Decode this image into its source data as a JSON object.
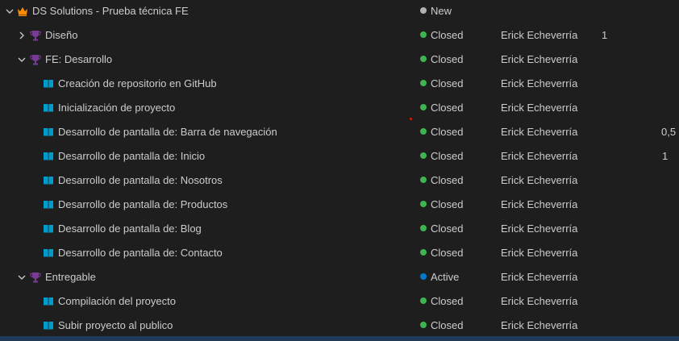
{
  "colors": {
    "background": "#1e1e1e",
    "text": "#cccccc",
    "closed": "#3fb34f",
    "new": "#b2b2b2",
    "active": "#007acc",
    "epic_icon": "#ff8c00",
    "feature_icon": "#773b93",
    "story_icon": "#009ccc"
  },
  "rows": [
    {
      "depth": 0,
      "chevron": "chevron-down",
      "icon": "crown-icon",
      "title": "DS Solutions - Prueba técnica FE",
      "state": "New",
      "state_color": "#b2b2b2",
      "assignee": "",
      "effort": ""
    },
    {
      "depth": 1,
      "chevron": "chevron-right",
      "icon": "trophy-icon",
      "title": "Diseño",
      "state": "Closed",
      "state_color": "#3fb34f",
      "assignee": "Erick Echeverría",
      "effort": "1"
    },
    {
      "depth": 1,
      "chevron": "chevron-down",
      "icon": "trophy-icon",
      "title": "FE: Desarrollo",
      "state": "Closed",
      "state_color": "#3fb34f",
      "assignee": "Erick Echeverría",
      "effort": ""
    },
    {
      "depth": 2,
      "chevron": "",
      "icon": "book-icon",
      "title": "Creación de repositorio en GitHub",
      "state": "Closed",
      "state_color": "#3fb34f",
      "assignee": "Erick Echeverría",
      "effort": ""
    },
    {
      "depth": 2,
      "chevron": "",
      "icon": "book-icon",
      "title": "Inicialización de proyecto",
      "state": "Closed",
      "state_color": "#3fb34f",
      "assignee": "Erick Echeverría",
      "effort": ""
    },
    {
      "depth": 2,
      "chevron": "",
      "icon": "book-icon",
      "title": "Desarrollo de pantalla de: Barra de navegación",
      "state": "Closed",
      "state_color": "#3fb34f",
      "assignee": "Erick Echeverría",
      "effort": "0,5"
    },
    {
      "depth": 2,
      "chevron": "",
      "icon": "book-icon",
      "title": "Desarrollo de pantalla de: Inicio",
      "state": "Closed",
      "state_color": "#3fb34f",
      "assignee": "Erick Echeverría",
      "effort": "1"
    },
    {
      "depth": 2,
      "chevron": "",
      "icon": "book-icon",
      "title": "Desarrollo de pantalla de: Nosotros",
      "state": "Closed",
      "state_color": "#3fb34f",
      "assignee": "Erick Echeverría",
      "effort": ""
    },
    {
      "depth": 2,
      "chevron": "",
      "icon": "book-icon",
      "title": "Desarrollo de pantalla de: Productos",
      "state": "Closed",
      "state_color": "#3fb34f",
      "assignee": "Erick Echeverría",
      "effort": ""
    },
    {
      "depth": 2,
      "chevron": "",
      "icon": "book-icon",
      "title": "Desarrollo de pantalla de: Blog",
      "state": "Closed",
      "state_color": "#3fb34f",
      "assignee": "Erick Echeverría",
      "effort": ""
    },
    {
      "depth": 2,
      "chevron": "",
      "icon": "book-icon",
      "title": "Desarrollo de pantalla de: Contacto",
      "state": "Closed",
      "state_color": "#3fb34f",
      "assignee": "Erick Echeverría",
      "effort": ""
    },
    {
      "depth": 1,
      "chevron": "chevron-down",
      "icon": "trophy-icon",
      "title": "Entregable",
      "state": "Active",
      "state_color": "#007acc",
      "assignee": "Erick Echeverría",
      "effort": ""
    },
    {
      "depth": 2,
      "chevron": "",
      "icon": "book-icon",
      "title": "Compilación del proyecto",
      "state": "Closed",
      "state_color": "#3fb34f",
      "assignee": "Erick Echeverría",
      "effort": ""
    },
    {
      "depth": 2,
      "chevron": "",
      "icon": "book-icon",
      "title": "Subir proyecto al publico",
      "state": "Closed",
      "state_color": "#3fb34f",
      "assignee": "Erick Echeverría",
      "effort": ""
    }
  ]
}
